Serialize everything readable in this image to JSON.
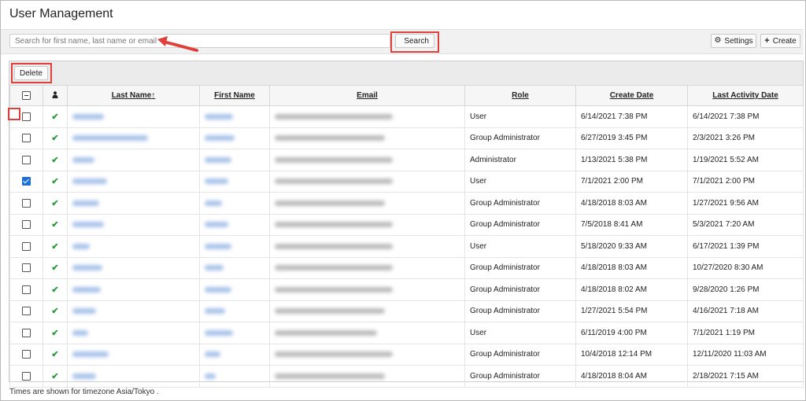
{
  "page": {
    "title": "User Management"
  },
  "toolbar": {
    "search_placeholder": "Search for first name, last name or email",
    "search_label": "Search",
    "settings_label": "Settings",
    "create_label": "Create"
  },
  "actions": {
    "delete_label": "Delete"
  },
  "table": {
    "headers": {
      "last_name": "Last Name",
      "last_name_sort": "↑",
      "first_name": "First Name",
      "email": "Email",
      "role": "Role",
      "create_date": "Create Date",
      "last_activity_date": "Last Activity Date"
    },
    "rows": [
      {
        "checked": false,
        "role": "User",
        "create_date": "6/14/2021 7:38 PM",
        "last_activity": "6/14/2021 7:38 PM"
      },
      {
        "checked": false,
        "role": "Group Administrator",
        "create_date": "6/27/2019 3:45 PM",
        "last_activity": "2/3/2021 3:26 PM"
      },
      {
        "checked": false,
        "role": "Administrator",
        "create_date": "1/13/2021 5:38 PM",
        "last_activity": "1/19/2021 5:52 AM"
      },
      {
        "checked": true,
        "role": "User",
        "create_date": "7/1/2021 2:00 PM",
        "last_activity": "7/1/2021 2:00 PM"
      },
      {
        "checked": false,
        "role": "Group Administrator",
        "create_date": "4/18/2018 8:03 AM",
        "last_activity": "1/27/2021 9:56 AM"
      },
      {
        "checked": false,
        "role": "Group Administrator",
        "create_date": "7/5/2018 8:41 AM",
        "last_activity": "5/3/2021 7:20 AM"
      },
      {
        "checked": false,
        "role": "User",
        "create_date": "5/18/2020 9:33 AM",
        "last_activity": "6/17/2021 1:39 PM"
      },
      {
        "checked": false,
        "role": "Group Administrator",
        "create_date": "4/18/2018 8:03 AM",
        "last_activity": "10/27/2020 8:30 AM"
      },
      {
        "checked": false,
        "role": "Group Administrator",
        "create_date": "4/18/2018 8:02 AM",
        "last_activity": "9/28/2020 1:26 PM"
      },
      {
        "checked": false,
        "role": "Group Administrator",
        "create_date": "1/27/2021 5:54 PM",
        "last_activity": "4/16/2021 7:18 AM"
      },
      {
        "checked": false,
        "role": "User",
        "create_date": "6/11/2019 4:00 PM",
        "last_activity": "7/1/2021 1:19 PM"
      },
      {
        "checked": false,
        "role": "Group Administrator",
        "create_date": "10/4/2018 12:14 PM",
        "last_activity": "12/11/2020 11:03 AM"
      },
      {
        "checked": false,
        "role": "Group Administrator",
        "create_date": "4/18/2018 8:04 AM",
        "last_activity": "2/18/2021 7:15 AM"
      }
    ]
  },
  "footer": {
    "timezone_note": "Times are shown for timezone Asia/Tokyo ."
  },
  "colors": {
    "highlight": "#e0403a",
    "link": "#1e6fd9",
    "active_check": "#2a9a3a"
  },
  "icons": {
    "search": "search-icon",
    "settings": "gear-icon",
    "create": "plus-icon",
    "active": "checkmark-icon",
    "user_column": "person-icon"
  }
}
